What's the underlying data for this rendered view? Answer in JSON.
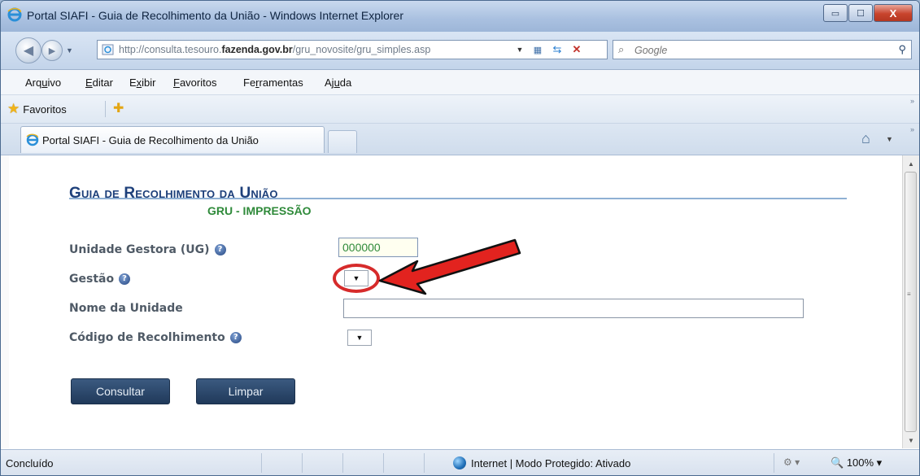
{
  "window": {
    "title": "Portal SIAFI - Guia de Recolhimento da União - Windows Internet Explorer",
    "minimize_glyph": "▭",
    "maximize_glyph": "☐",
    "close_glyph": "X"
  },
  "address": {
    "url_prefix": "http://consulta.tesouro.",
    "url_domain": "fazenda.gov.br",
    "url_path": "/gru_novosite/gru_simples.asp"
  },
  "search": {
    "placeholder": "Google"
  },
  "menu": {
    "items": [
      {
        "pre": "Arq",
        "key": "u",
        "post": "ivo"
      },
      {
        "pre": "",
        "key": "E",
        "post": "ditar"
      },
      {
        "pre": "E",
        "key": "x",
        "post": "ibir"
      },
      {
        "pre": "",
        "key": "F",
        "post": "avoritos"
      },
      {
        "pre": "Fe",
        "key": "r",
        "post": "ramentas"
      },
      {
        "pre": "Aj",
        "key": "u",
        "post": "da"
      }
    ]
  },
  "favorites": {
    "label": "Favoritos"
  },
  "tab": {
    "label": "Portal SIAFI - Guia de Recolhimento da União"
  },
  "page": {
    "title": "Guia de Recolhimento da União",
    "subtitle": "GRU - IMPRESSÃO",
    "fields": {
      "ug": {
        "label": "Unidade Gestora (UG)",
        "value": "000000"
      },
      "gestao": {
        "label": "Gestão"
      },
      "nome": {
        "label": "Nome da Unidade"
      },
      "codigo": {
        "label": "Código de Recolhimento"
      }
    },
    "help_glyph": "?",
    "buttons": {
      "consultar": "Consultar",
      "limpar": "Limpar"
    }
  },
  "status": {
    "text": "Concluído",
    "zone": "Internet | Modo Protegido: Ativado",
    "zoom": "100%"
  },
  "colors": {
    "title_blue": "#1d3f7a",
    "subtitle_green": "#2f8a3a",
    "arrow_red": "#d62b2b",
    "button_navy": "#2b4669"
  }
}
